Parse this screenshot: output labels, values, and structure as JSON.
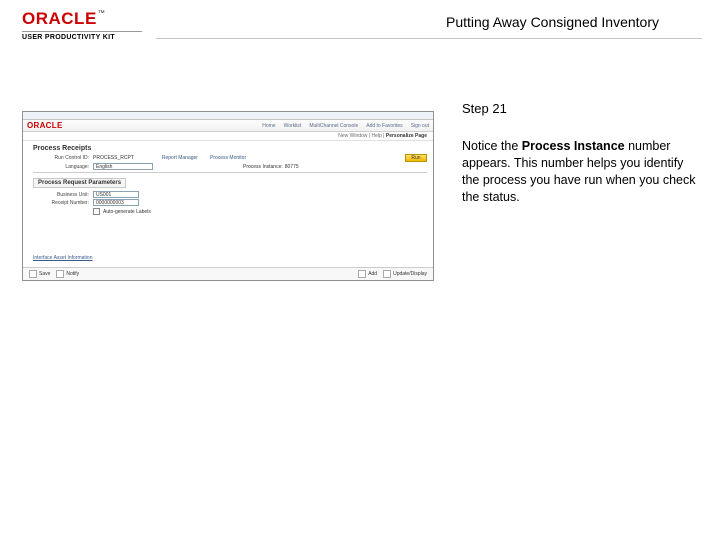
{
  "header": {
    "logo_text": "ORACLE",
    "logo_subtext": "USER PRODUCTIVITY KIT",
    "title": "Putting Away Consigned Inventory"
  },
  "instruction": {
    "step_label": "Step 21",
    "text_before": "Notice the ",
    "bold": "Process Instance",
    "text_after": " number appears. This number helps you identify the process you have run when you check the status."
  },
  "app": {
    "brand": "ORACLE",
    "nav": {
      "home": "Home",
      "worklist": "Worklist",
      "mclink": "MultiChannel Console",
      "addfav": "Add to Favorites",
      "signout": "Sign out"
    },
    "subbar": {
      "newwin": "New Window",
      "help": "Help",
      "personalize": "Personalize Page"
    },
    "section_title": "Process Receipts",
    "fields": {
      "run_control_label": "Run Control ID:",
      "run_control_value": "PROCESS_RCPT",
      "report_mgr_label": "Report Manager",
      "process_mon_label": "Process Monitor",
      "run_btn": "Run",
      "language_label": "Language:",
      "language_value": "English",
      "proc_inst_label": "Process Instance:",
      "proc_inst_value": "80775"
    },
    "prp_title": "Process Request Parameters",
    "prp": {
      "bu_label": "Business Unit:",
      "bu_value": "US001",
      "recv_label": "Receipt Number:",
      "recv_value": "0000000003",
      "autogen_label": "Auto-generate Labels"
    },
    "archive_link": "Interface Asset Information",
    "footer": {
      "save": "Save",
      "notify": "Notify",
      "add": "Add",
      "update": "Update/Display"
    }
  }
}
